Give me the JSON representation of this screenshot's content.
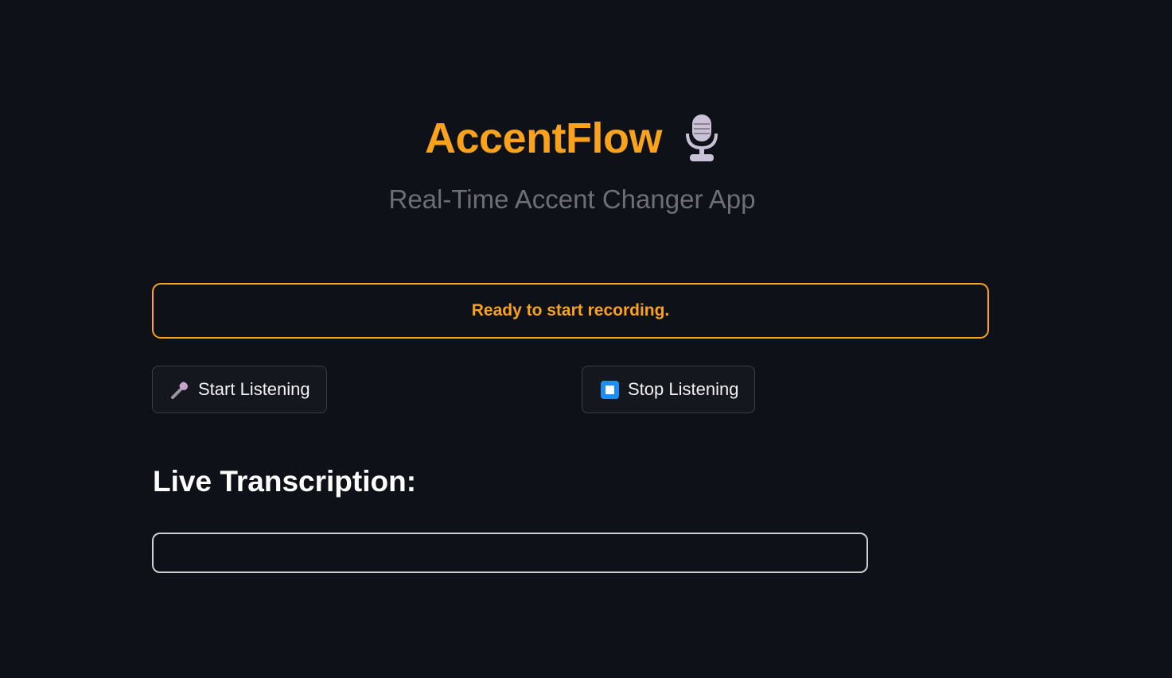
{
  "header": {
    "title": "AccentFlow",
    "title_icon": "studio-microphone-icon",
    "subtitle": "Real-Time Accent Changer App"
  },
  "status": {
    "message": "Ready to start recording."
  },
  "controls": {
    "start_label": "Start Listening",
    "start_icon": "microphone-icon",
    "stop_label": "Stop Listening",
    "stop_icon": "stop-icon"
  },
  "transcription": {
    "heading": "Live Transcription:",
    "text": ""
  },
  "colors": {
    "background": "#0e1117",
    "accent": "#f9a21a",
    "subtitle": "#6e6e75",
    "stop_icon": "#1f8ef1"
  }
}
